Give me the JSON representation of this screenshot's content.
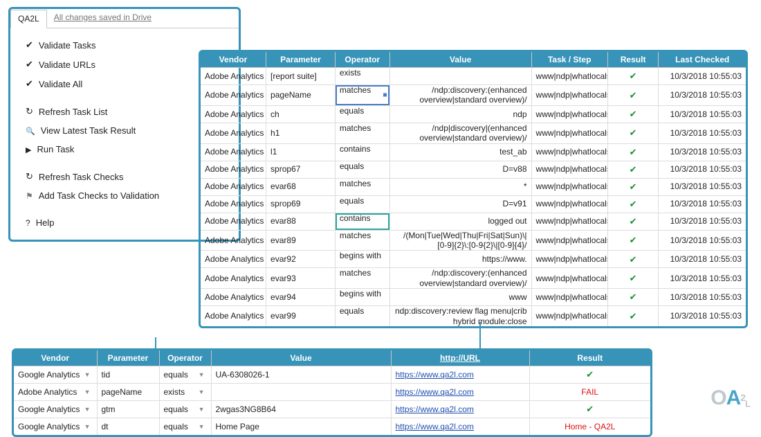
{
  "colors": {
    "accent": "#3793b7",
    "pass": "#1a8f2c",
    "fail": "#d11"
  },
  "sidebar": {
    "tab_active": "QA2L",
    "tab_save": "All changes saved in Drive",
    "items": [
      {
        "icon": "chk",
        "label": "Validate Tasks"
      },
      {
        "icon": "chk",
        "label": "Validate URLs"
      },
      {
        "icon": "chk",
        "label": "Validate All"
      },
      {
        "gap": true
      },
      {
        "icon": "refresh",
        "label": "Refresh Task List"
      },
      {
        "icon": "search",
        "label": "View Latest Task Result"
      },
      {
        "icon": "play",
        "label": "Run Task"
      },
      {
        "gap": true
      },
      {
        "icon": "refresh",
        "label": "Refresh Task Checks"
      },
      {
        "icon": "flag",
        "label": "Add Task Checks to Validation"
      },
      {
        "gap": true
      },
      {
        "icon": "help",
        "label": "Help"
      }
    ]
  },
  "top": {
    "headers": [
      "Vendor",
      "Parameter",
      "Operator",
      "Value",
      "Task / Step",
      "Result",
      "Last Checked"
    ],
    "rows": [
      {
        "vendor": "Adobe Analytics",
        "param": "[report suite]",
        "op": "exists",
        "op_sel": "",
        "val": "",
        "task": "www|ndp|whatlocals:",
        "res": "pass",
        "ts": "10/3/2018 10:55:03"
      },
      {
        "vendor": "Adobe Analytics",
        "param": "pageName",
        "op": "matches",
        "op_sel": "blue",
        "val": "/ndp:discovery:(enhanced overview|standard overview)/",
        "task": "www|ndp|whatlocals:",
        "res": "pass",
        "ts": "10/3/2018 10:55:03",
        "wrap": true
      },
      {
        "vendor": "Adobe Analytics",
        "param": "ch",
        "op": "equals",
        "op_sel": "",
        "val": "ndp",
        "task": "www|ndp|whatlocals:",
        "res": "pass",
        "ts": "10/3/2018 10:55:03"
      },
      {
        "vendor": "Adobe Analytics",
        "param": "h1",
        "op": "matches",
        "op_sel": "",
        "val": "/ndp|discovery|(enhanced overview|standard overview)/",
        "task": "www|ndp|whatlocals:",
        "res": "pass",
        "ts": "10/3/2018 10:55:03",
        "wrap": true
      },
      {
        "vendor": "Adobe Analytics",
        "param": "l1",
        "op": "contains",
        "op_sel": "",
        "val": "test_ab",
        "task": "www|ndp|whatlocals:",
        "res": "pass",
        "ts": "10/3/2018 10:55:03"
      },
      {
        "vendor": "Adobe Analytics",
        "param": "sprop67",
        "op": "equals",
        "op_sel": "",
        "val": "D=v88",
        "task": "www|ndp|whatlocals:",
        "res": "pass",
        "ts": "10/3/2018 10:55:03"
      },
      {
        "vendor": "Adobe Analytics",
        "param": "evar68",
        "op": "matches",
        "op_sel": "",
        "val": "*",
        "task": "www|ndp|whatlocals:",
        "res": "pass",
        "ts": "10/3/2018 10:55:03"
      },
      {
        "vendor": "Adobe Analytics",
        "param": "sprop69",
        "op": "equals",
        "op_sel": "",
        "val": "D=v91",
        "task": "www|ndp|whatlocals:",
        "res": "pass",
        "ts": "10/3/2018 10:55:03"
      },
      {
        "vendor": "Adobe Analytics",
        "param": "evar88",
        "op": "contains",
        "op_sel": "teal",
        "val": "logged out",
        "task": "www|ndp|whatlocals:",
        "res": "pass",
        "ts": "10/3/2018 10:55:03"
      },
      {
        "vendor": "Adobe Analytics",
        "param": "evar89",
        "op": "matches",
        "op_sel": "",
        "val": "/(Mon|Tue|Wed|Thu|Fri|Sat|Sun)\\|[0-9]{2}\\:[0-9{2}\\|[0-9]{4}/",
        "task": "www|ndp|whatlocals:",
        "res": "pass",
        "ts": "10/3/2018 10:55:03",
        "wrap": true
      },
      {
        "vendor": "Adobe Analytics",
        "param": "evar92",
        "op": "begins with",
        "op_sel": "",
        "val": "https://www.",
        "task": "www|ndp|whatlocals:",
        "res": "pass",
        "ts": "10/3/2018 10:55:03"
      },
      {
        "vendor": "Adobe Analytics",
        "param": "evar93",
        "op": "matches",
        "op_sel": "",
        "val": "/ndp:discovery:(enhanced overview|standard overview)/",
        "task": "www|ndp|whatlocals:",
        "res": "pass",
        "ts": "10/3/2018 10:55:03",
        "wrap": true
      },
      {
        "vendor": "Adobe Analytics",
        "param": "evar94",
        "op": "begins with",
        "op_sel": "",
        "val": "www",
        "task": "www|ndp|whatlocals:",
        "res": "pass",
        "ts": "10/3/2018 10:55:03"
      },
      {
        "vendor": "Adobe Analytics",
        "param": "evar99",
        "op": "equals",
        "op_sel": "",
        "val": "ndp:discovery:review flag menu|crib hybrid module:close",
        "task": "www|ndp|whatlocals:",
        "res": "pass",
        "ts": "10/3/2018 10:55:03",
        "wrap": true
      }
    ]
  },
  "bottom": {
    "headers": [
      "Vendor",
      "Parameter",
      "Operator",
      "Value",
      "http://URL",
      "Result"
    ],
    "rows": [
      {
        "vendor": "Google Analytics",
        "param": "tid",
        "op": "equals",
        "val": "UA-6308026-1",
        "url": "https://www.qa2l.com",
        "res": "pass"
      },
      {
        "vendor": "Adobe Analytics",
        "param": "pageName",
        "op": "exists",
        "val": "",
        "url": "https://www.qa2l.com",
        "res": "FAIL"
      },
      {
        "vendor": "Google Analytics",
        "param": "gtm",
        "op": "equals",
        "val": "2wgas3NG8B64",
        "url": "https://www.qa2l.com",
        "res": "pass"
      },
      {
        "vendor": "Google Analytics",
        "param": "dt",
        "op": "equals",
        "val": "Home Page",
        "url": "https://www.qa2l.com",
        "res": "Home - QA2L"
      }
    ]
  },
  "logo": {
    "text": "OA2L"
  }
}
